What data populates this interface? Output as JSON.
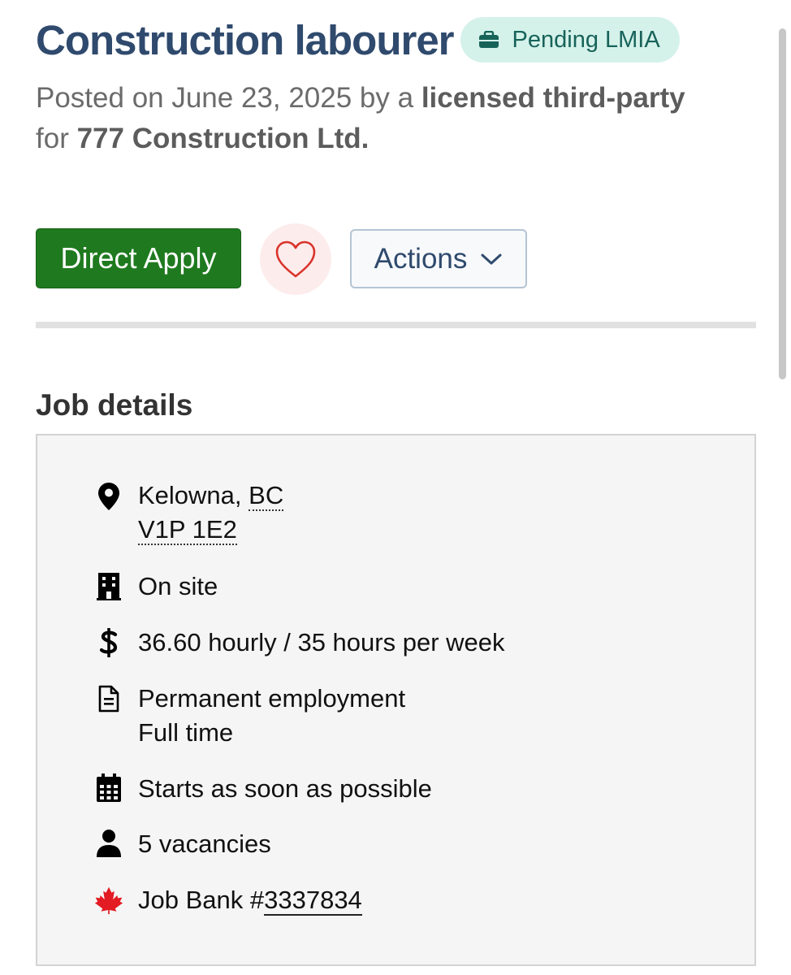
{
  "job": {
    "title": "Construction labourer",
    "badge": "Pending LMIA",
    "posted_prefix": "Posted on June 23, 2025 by a",
    "posted_by": "licensed third-party",
    "for_prefix": "for",
    "employer": "777 Construction Ltd."
  },
  "actions": {
    "apply_label": "Direct Apply",
    "actions_label": "Actions"
  },
  "details": {
    "heading": "Job details",
    "city": "Kelowna,",
    "province": "BC",
    "postal_code": "V1P 1E2",
    "work_location": "On site",
    "pay": "36.60 hourly / 35 hours per week",
    "employment_type": "Permanent employment",
    "schedule": "Full time",
    "start": "Starts as soon as possible",
    "vacancies": "5 vacancies",
    "job_bank_prefix": "Job Bank #",
    "job_bank_number": "3337834"
  },
  "icons": {
    "badge": "briefcase-icon",
    "favorite": "heart-icon",
    "actions": "chevron-down-icon",
    "location": "map-pin-icon",
    "work_location": "building-icon",
    "pay": "dollar-icon",
    "employment": "document-icon",
    "start": "calendar-icon",
    "vacancies": "person-icon",
    "job_bank": "maple-leaf-icon"
  },
  "colors": {
    "title": "#2f4a6d",
    "badge_bg": "#d5f2ea",
    "badge_text": "#17635a",
    "apply_bg": "#1f7a1f",
    "heart": "#d9342b",
    "maple_leaf": "#e31b23"
  }
}
